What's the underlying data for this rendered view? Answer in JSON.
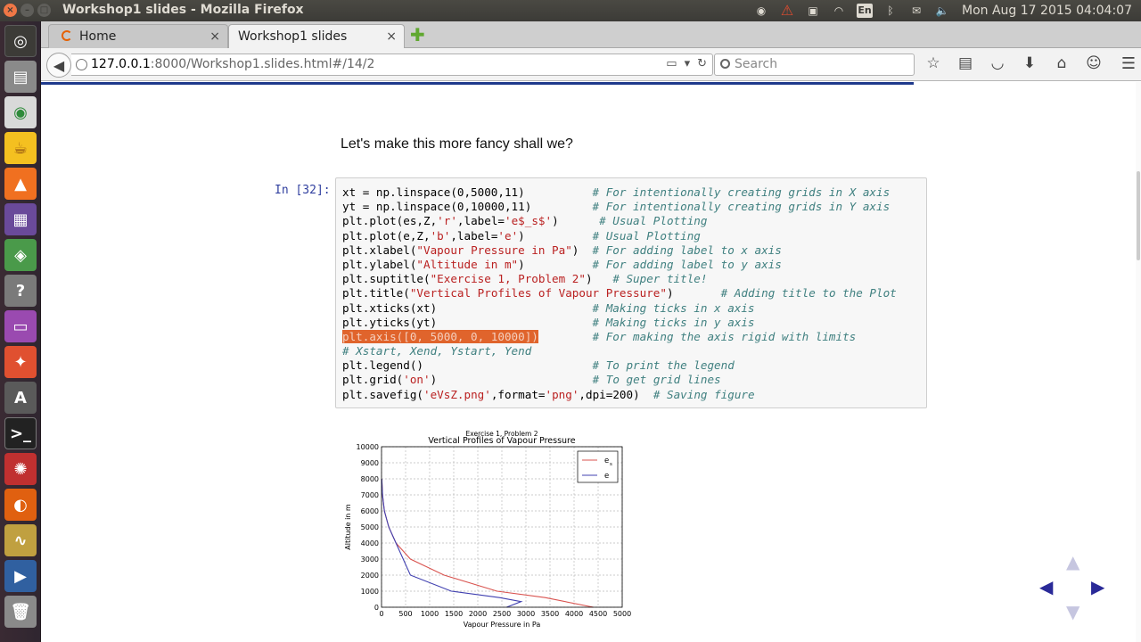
{
  "window": {
    "title": "Workshop1 slides - Mozilla Firefox"
  },
  "indicators": {
    "keyboard": "En",
    "clock": "Mon Aug 17 2015 04:04:07"
  },
  "tabs": [
    {
      "label": "Home",
      "active": false
    },
    {
      "label": "Workshop1 slides",
      "active": true
    }
  ],
  "nav": {
    "url_host": "127.0.0.1",
    "url_rest": ":8000/Workshop1.slides.html#/14/2",
    "search_placeholder": "Search"
  },
  "slide": {
    "text": "Let's make this more fancy shall we?",
    "prompt": "In [32]:",
    "code_lines": [
      [
        [
          "xt = np.linspace(0,5000,11)          ",
          ""
        ],
        [
          "# For intentionally creating grids in X axis",
          "com"
        ]
      ],
      [
        [
          "yt = np.linspace(0,10000,11)         ",
          ""
        ],
        [
          "# For intentionally creating grids in Y axis",
          "com"
        ]
      ],
      [
        [
          "plt.plot(es,Z,",
          ""
        ],
        [
          "'r'",
          "str"
        ],
        [
          ",label=",
          ""
        ],
        [
          "'e$_s$'",
          "str"
        ],
        [
          ")      ",
          ""
        ],
        [
          "# Usual Plotting",
          "com"
        ]
      ],
      [
        [
          "plt.plot(e,Z,",
          ""
        ],
        [
          "'b'",
          "str"
        ],
        [
          ",label=",
          ""
        ],
        [
          "'e'",
          "str"
        ],
        [
          ")          ",
          ""
        ],
        [
          "# Usual Plotting",
          "com"
        ]
      ],
      [
        [
          "plt.xlabel(",
          ""
        ],
        [
          "\"Vapour Pressure in Pa\"",
          "str"
        ],
        [
          ")  ",
          ""
        ],
        [
          "# For adding label to x axis",
          "com"
        ]
      ],
      [
        [
          "plt.ylabel(",
          ""
        ],
        [
          "\"Altitude in m\"",
          "str"
        ],
        [
          ")          ",
          ""
        ],
        [
          "# For adding label to y axis",
          "com"
        ]
      ],
      [
        [
          "plt.suptitle(",
          ""
        ],
        [
          "\"Exercise 1, Problem 2\"",
          "str"
        ],
        [
          ")   ",
          ""
        ],
        [
          "# Super title!",
          "com"
        ]
      ],
      [
        [
          "plt.title(",
          ""
        ],
        [
          "\"Vertical Profiles of Vapour Pressure\"",
          "str"
        ],
        [
          ")       ",
          ""
        ],
        [
          "# Adding title to the Plot",
          "com"
        ]
      ],
      [
        [
          "plt.xticks(xt)                       ",
          ""
        ],
        [
          "# Making ticks in x axis",
          "com"
        ]
      ],
      [
        [
          "plt.yticks(yt)                       ",
          ""
        ],
        [
          "# Making ticks in y axis",
          "com"
        ]
      ],
      [
        [
          "plt.axis([0, 5000, 0, 10000])",
          "hl"
        ],
        [
          "        ",
          ""
        ],
        [
          "# For making the axis rigid with limits",
          "com"
        ]
      ],
      [
        [
          "# Xstart, Xend, Ystart, Yend",
          "com"
        ]
      ],
      [
        [
          "plt.legend()                         ",
          ""
        ],
        [
          "# To print the legend",
          "com"
        ]
      ],
      [
        [
          "plt.grid(",
          ""
        ],
        [
          "'on'",
          "str"
        ],
        [
          ")                       ",
          ""
        ],
        [
          "# To get grid lines",
          "com"
        ]
      ],
      [
        [
          "plt.savefig(",
          ""
        ],
        [
          "'eVsZ.png'",
          "str"
        ],
        [
          ",format=",
          ""
        ],
        [
          "'png'",
          "str"
        ],
        [
          ",dpi=200)  ",
          ""
        ],
        [
          "# Saving figure",
          "com"
        ]
      ]
    ]
  },
  "chart_data": {
    "type": "line",
    "suptitle": "Exercise 1, Problem 2",
    "title": "Vertical Profiles of Vapour Pressure",
    "xlabel": "Vapour Pressure in Pa",
    "ylabel": "Altitude in m",
    "xlim": [
      0,
      5000
    ],
    "ylim": [
      0,
      10000
    ],
    "xticks": [
      0,
      500,
      1000,
      1500,
      2000,
      2500,
      3000,
      3500,
      4000,
      4500,
      5000
    ],
    "yticks": [
      0,
      1000,
      2000,
      3000,
      4000,
      5000,
      6000,
      7000,
      8000,
      9000,
      10000
    ],
    "grid": true,
    "legend_position": "top-right",
    "series": [
      {
        "name": "es",
        "legend_label": "e",
        "legend_subscript": "s",
        "color": "#d9534f",
        "x": [
          4400,
          3400,
          2400,
          1300,
          600,
          300,
          150,
          60,
          20,
          5
        ],
        "y": [
          0,
          600,
          1000,
          2000,
          3000,
          4000,
          5000,
          6000,
          7000,
          8000
        ]
      },
      {
        "name": "e",
        "legend_label": "e",
        "color": "#4040b0",
        "x": [
          2600,
          2900,
          2450,
          1450,
          600,
          300,
          150,
          60,
          20,
          5
        ],
        "y": [
          0,
          350,
          600,
          1000,
          2000,
          4000,
          5000,
          6000,
          7000,
          8000
        ]
      }
    ]
  }
}
